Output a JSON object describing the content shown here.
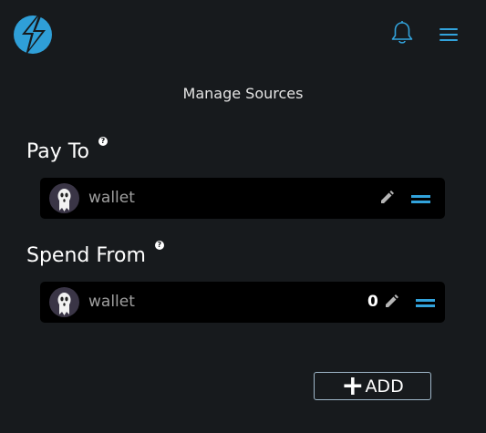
{
  "header": {
    "logo_icon": "lightning-bolt-icon",
    "notifications_icon": "bell-icon",
    "menu_icon": "hamburger-menu-icon"
  },
  "page": {
    "title": "Manage Sources"
  },
  "pay_to": {
    "title": "Pay To",
    "help_icon": "help-icon",
    "help_glyph": "?",
    "sources": [
      {
        "name": "wallet",
        "amount": ""
      }
    ]
  },
  "spend_from": {
    "title": "Spend From",
    "help_icon": "help-icon",
    "help_glyph": "?",
    "sources": [
      {
        "name": "wallet",
        "amount": "0"
      }
    ]
  },
  "add_button": {
    "plus": "+",
    "label": "ADD"
  },
  "colors": {
    "background": "#171a1d",
    "row_background": "#000000",
    "accent": "#32a3dc",
    "avatar_background": "#3a3546"
  }
}
